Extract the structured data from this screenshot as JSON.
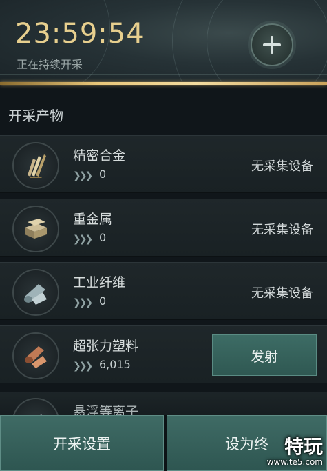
{
  "header": {
    "timer": "23:59:54",
    "status": "正在持续开采",
    "add_icon": "plus-icon"
  },
  "section": {
    "title": "开采产物"
  },
  "items": [
    {
      "name": "精密合金",
      "quantity": "0",
      "status": "无采集设备",
      "icon": "alloy-icon"
    },
    {
      "name": "重金属",
      "quantity": "0",
      "status": "无采集设备",
      "icon": "heavy-metal-icon"
    },
    {
      "name": "工业纤维",
      "quantity": "0",
      "status": "无采集设备",
      "icon": "fiber-icon"
    },
    {
      "name": "超张力塑料",
      "quantity": "6,015",
      "action": "发射",
      "icon": "plastic-icon"
    },
    {
      "name": "悬浮等离子",
      "icon": "plasma-icon"
    }
  ],
  "bottom": {
    "left_button": "开采设置",
    "right_button": "设为终"
  },
  "watermark": {
    "brand": "特玩",
    "url": "www.te5.com"
  },
  "colors": {
    "accent_gold": "#e7cf8e",
    "button_teal": "#3d6c65"
  }
}
